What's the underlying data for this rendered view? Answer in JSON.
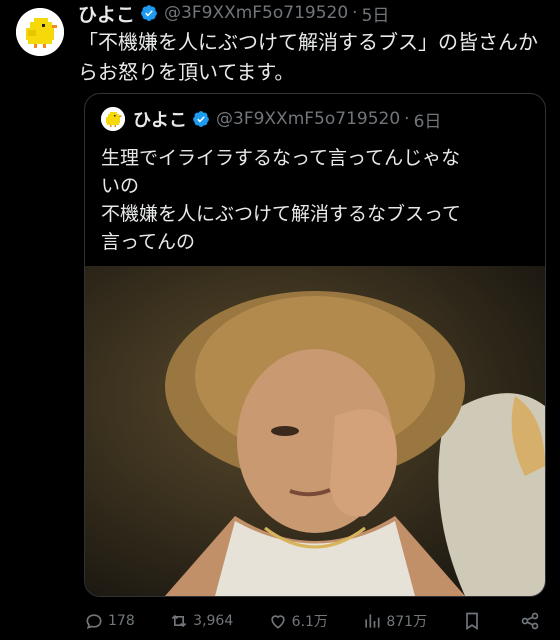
{
  "tweet": {
    "name": "ひよこ",
    "handle": "@3F9XXmF5o719520",
    "separator": "·",
    "time": "5日",
    "text": "「不機嫌を人にぶつけて解消するブス」の皆さんからお怒りを頂いてます。"
  },
  "quote": {
    "name": "ひよこ",
    "handle": "@3F9XXmF5o719520",
    "separator": "·",
    "time": "6日",
    "lines": [
      "生理でイライラするなって言ってんじゃな",
      "いの",
      "不機嫌を人にぶつけて解消するなブスって",
      "言ってんの"
    ]
  },
  "actions": {
    "reply_count": "178",
    "repost_count": "3,964",
    "like_count": "6.1万",
    "views_count": "871万"
  },
  "colors": {
    "background": "#000000",
    "text": "#e7e9ea",
    "muted": "#71767b",
    "verified": "#1d9bf0",
    "border": "#2f3336"
  },
  "icons": [
    "chick-avatar",
    "verified-badge-icon",
    "reply-icon",
    "repost-icon",
    "like-icon",
    "views-icon",
    "bookmark-icon",
    "share-icon"
  ]
}
